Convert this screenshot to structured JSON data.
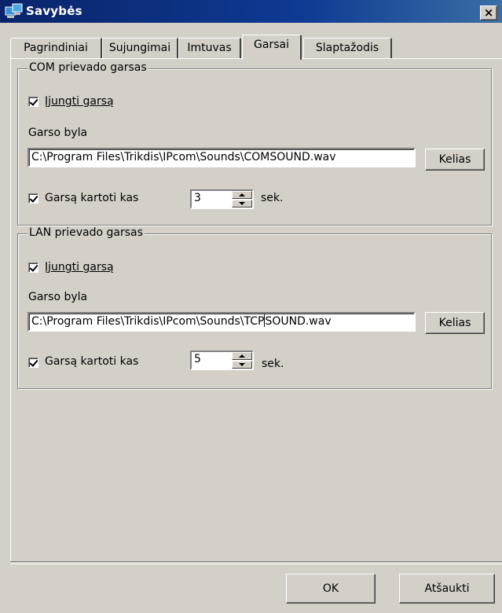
{
  "window": {
    "title": "Savybės",
    "close_label": "×"
  },
  "tabs": [
    {
      "label": "Pagrindiniai",
      "active": false
    },
    {
      "label": "Sujungimai",
      "active": false
    },
    {
      "label": "Imtuvas",
      "active": false
    },
    {
      "label": "Garsai",
      "active": true
    },
    {
      "label": "Slaptažodis",
      "active": false
    }
  ],
  "com_group": {
    "title": "COM prievado garsas",
    "enable_label": "Įjungti garsą",
    "enable_checked": true,
    "file_label": "Garso byla",
    "file_path": "C:\\Program Files\\Trikdis\\IPcom\\Sounds\\COMSOUND.wav",
    "browse_label": "Kelias",
    "repeat_label": "Garsą kartoti kas",
    "repeat_checked": true,
    "repeat_value": "3",
    "unit_label": "sek."
  },
  "lan_group": {
    "title": "LAN prievado garsas",
    "enable_label": "Įjungti garsą",
    "enable_checked": true,
    "file_label": "Garso byla",
    "file_path_before_caret": "C:\\Program Files\\Trikdis\\IPcom\\Sounds\\TCP",
    "file_path_after_caret": "SOUND.wav",
    "browse_label": "Kelias",
    "repeat_label": "Garsą kartoti kas",
    "repeat_checked": true,
    "repeat_value": "5",
    "unit_label": "sek."
  },
  "footer": {
    "ok_label": "OK",
    "cancel_label": "Atšaukti"
  }
}
